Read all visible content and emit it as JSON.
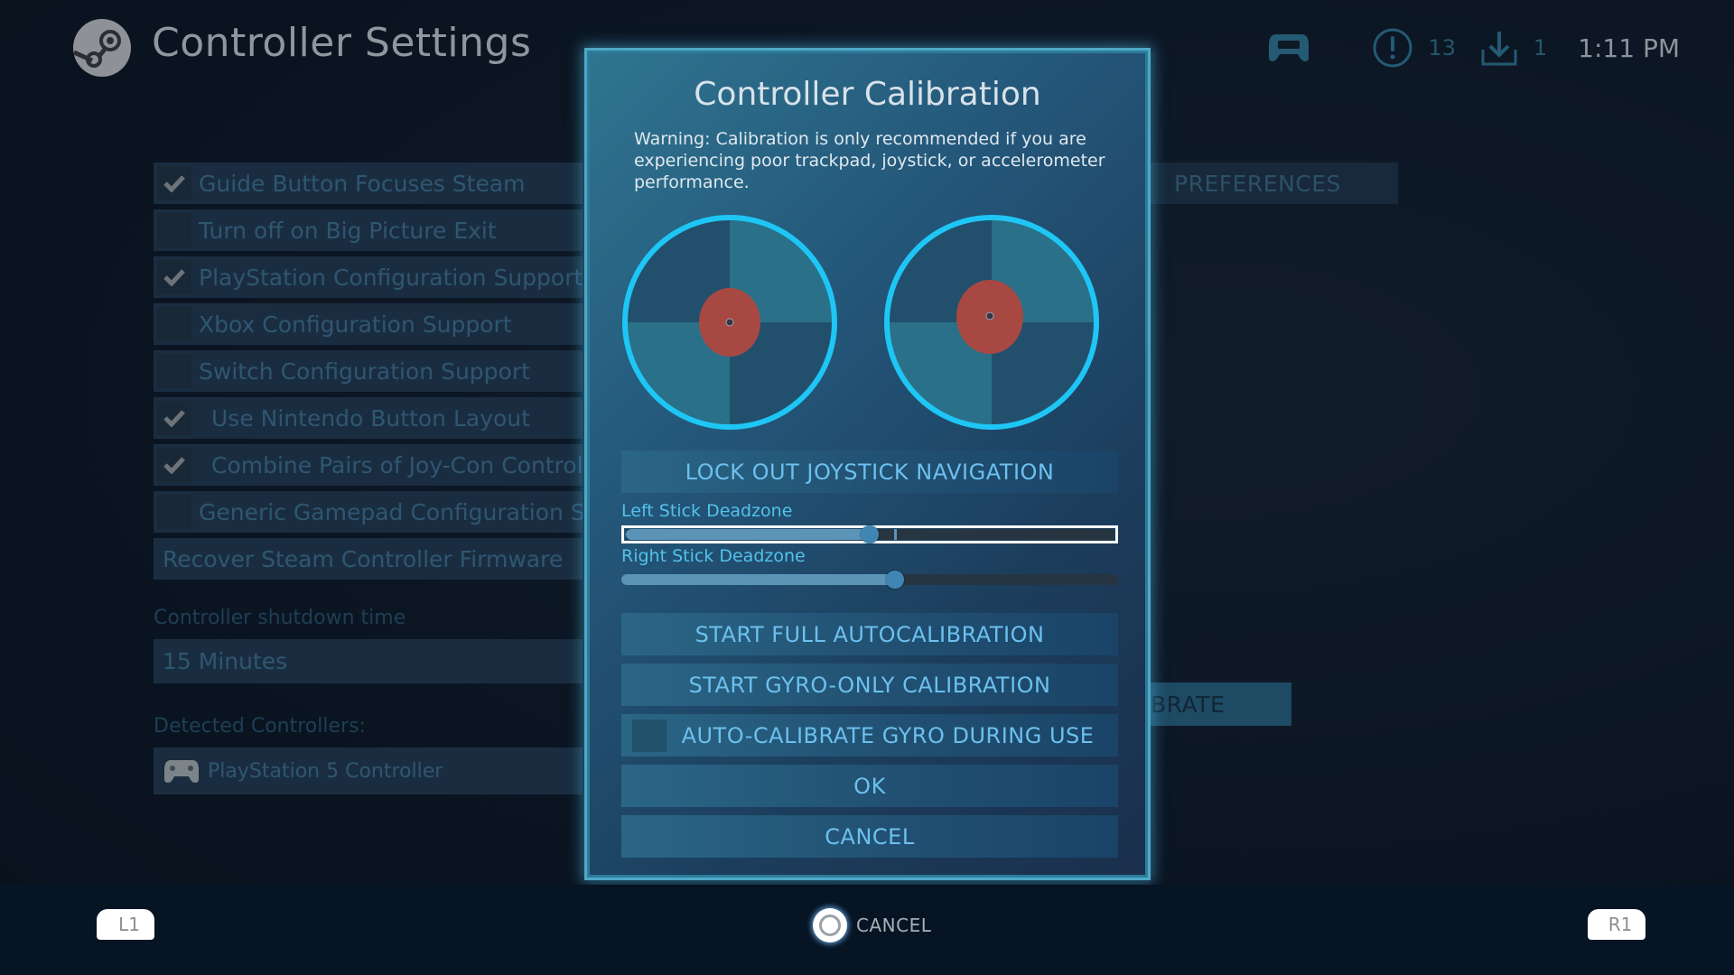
{
  "header": {
    "title": "Controller Settings",
    "notifications_count": "13",
    "downloads_count": "1",
    "clock": "1:11 PM"
  },
  "settings": {
    "rows": [
      {
        "label": "Guide Button Focuses Steam",
        "checked": true
      },
      {
        "label": "Turn off on Big Picture Exit",
        "checked": false
      },
      {
        "label": "PlayStation Configuration Support",
        "checked": true
      },
      {
        "label": "Xbox Configuration Support",
        "checked": false
      },
      {
        "label": "Switch Configuration Support",
        "checked": false
      },
      {
        "label": "Use Nintendo Button Layout",
        "checked": true
      },
      {
        "label": "Combine Pairs of Joy-Con Controllers",
        "checked": true
      },
      {
        "label": "Generic Gamepad Configuration Support",
        "checked": false
      }
    ],
    "recover_firmware_label": "Recover Steam Controller Firmware",
    "shutdown_label": "Controller shutdown time",
    "shutdown_value": "15 Minutes",
    "detected_label": "Detected Controllers:",
    "detected_controller": "PlayStation 5 Controller",
    "preferences_tab": "PREFERENCES",
    "calibrate_button_partial": "BRATE"
  },
  "dialog": {
    "title": "Controller Calibration",
    "warning": "Warning: Calibration is only recommended if you are experiencing poor trackpad, joystick, or accelerometer performance.",
    "lock_out_label": "LOCK OUT JOYSTICK NAVIGATION",
    "left_stick": {
      "label": "Left Stick Deadzone",
      "value_fraction": 0.5,
      "default_fraction": 0.55
    },
    "right_stick": {
      "label": "Right Stick Deadzone",
      "value_fraction": 0.55
    },
    "full_autocalibration_label": "START FULL AUTOCALIBRATION",
    "gyro_only_label": "START GYRO-ONLY CALIBRATION",
    "auto_calibrate_gyro_label": "AUTO-CALIBRATE GYRO DURING USE",
    "auto_calibrate_gyro_checked": false,
    "ok_label": "OK",
    "cancel_label": "CANCEL",
    "colors": {
      "ring": "#1ec6f5",
      "deadzone": "#a84843",
      "accent_text": "#6cc0ee"
    }
  },
  "footer": {
    "left_shoulder": "L1",
    "right_shoulder": "R1",
    "cancel_label": "CANCEL"
  }
}
